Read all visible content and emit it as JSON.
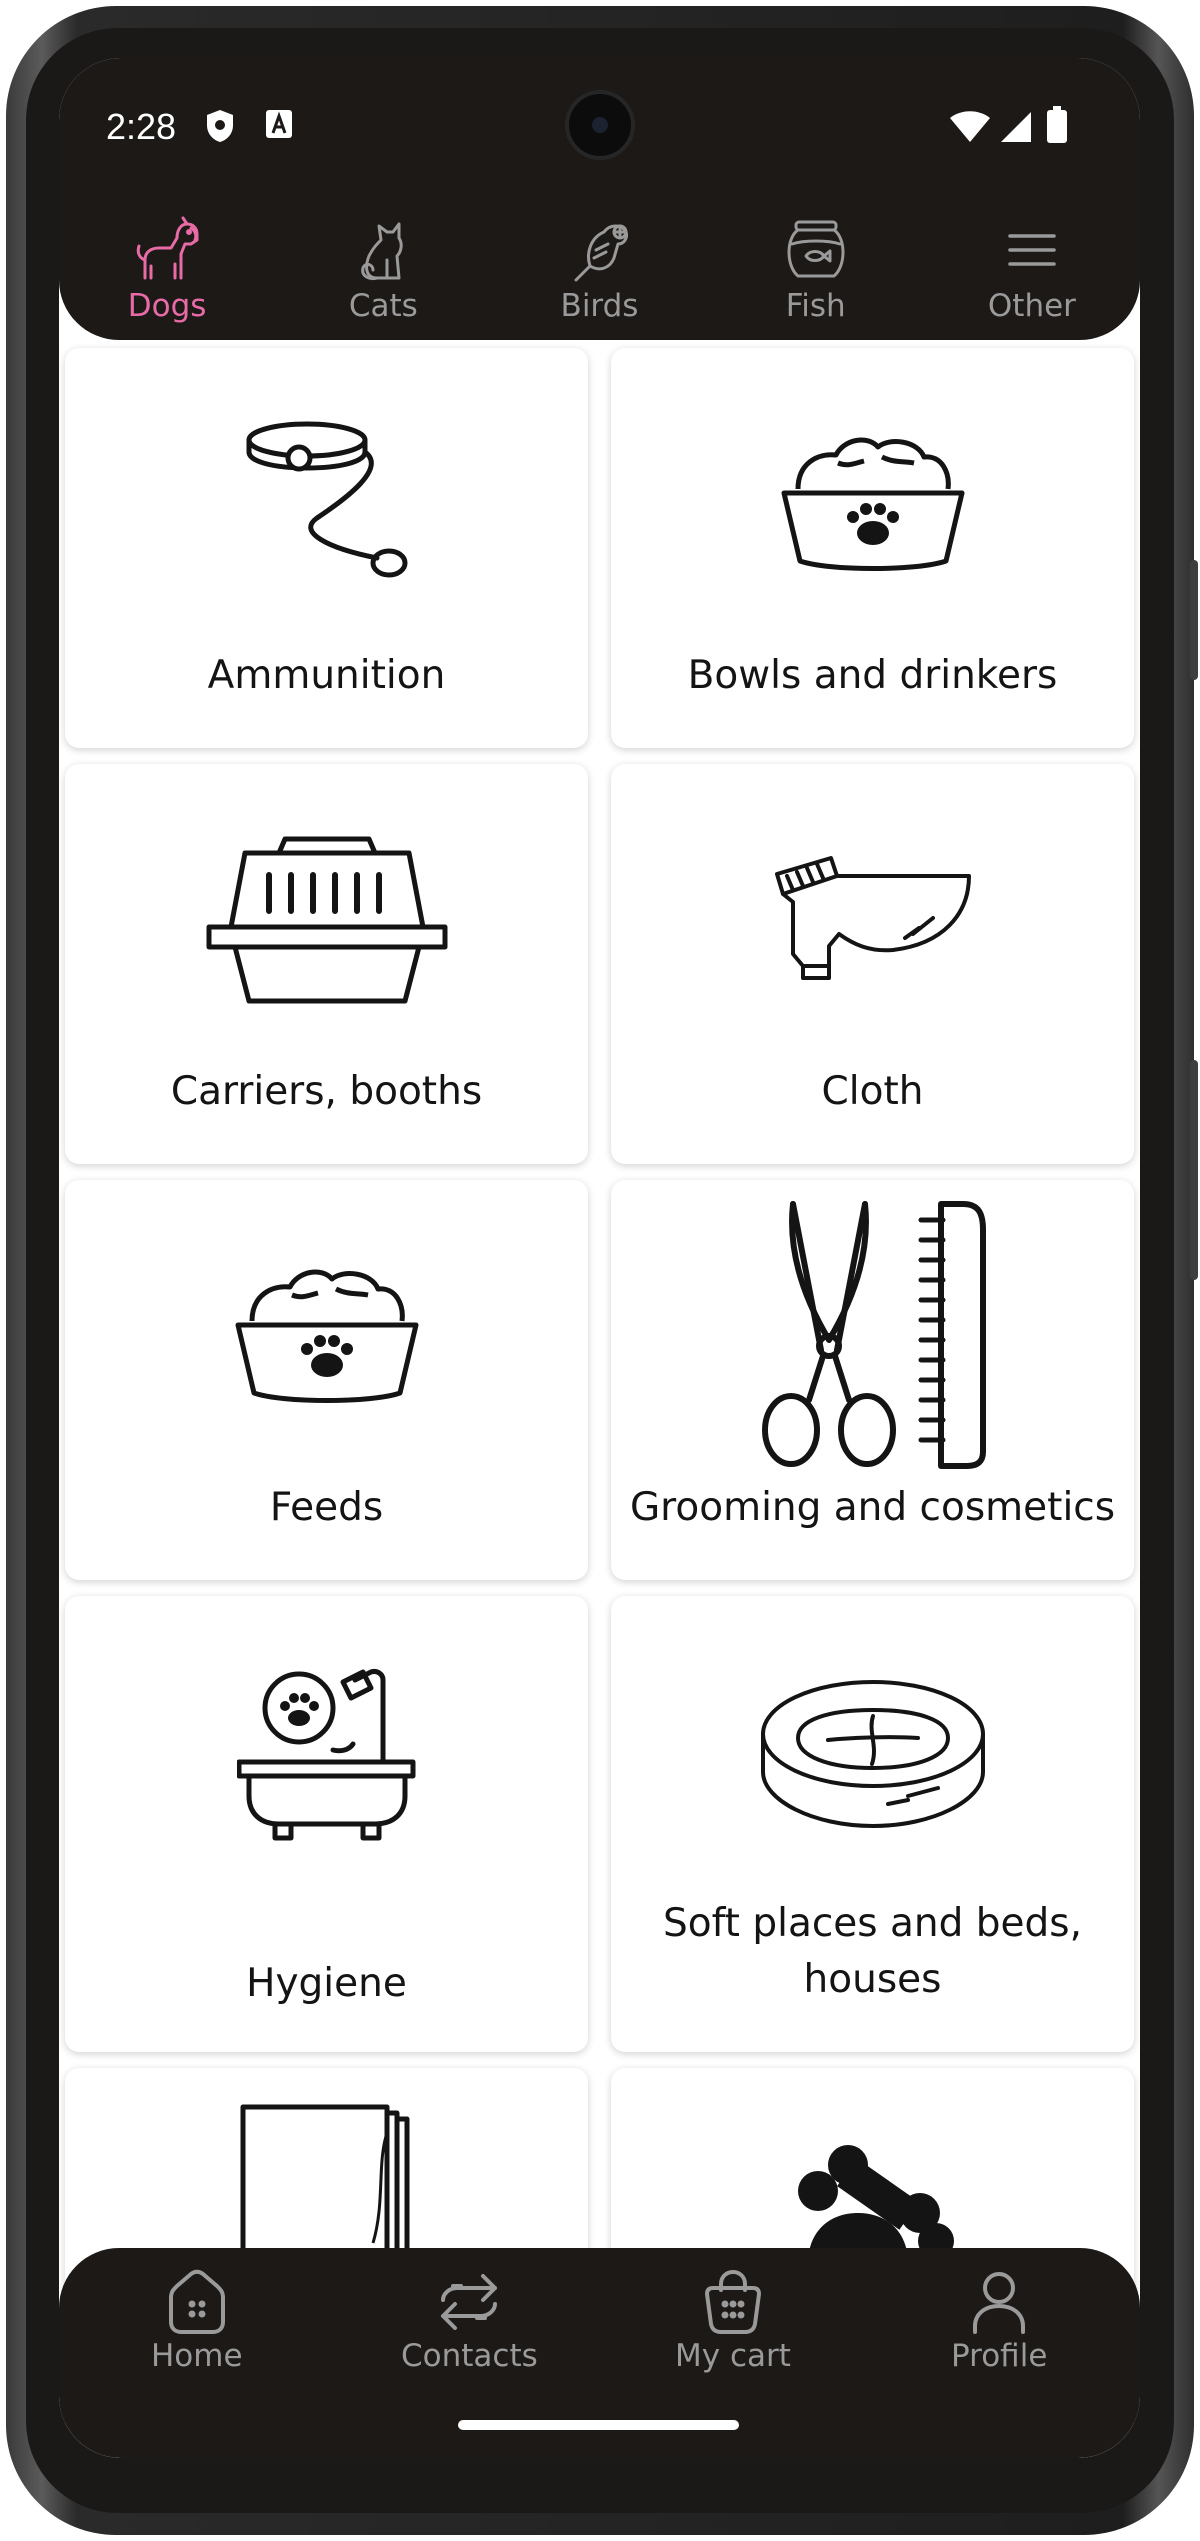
{
  "status_bar": {
    "time": "2:28",
    "icons": [
      "shield-icon",
      "a-icon",
      "wifi-icon",
      "signal-icon",
      "battery-icon"
    ]
  },
  "top_tabs": [
    {
      "label": "Dogs",
      "icon": "dog-icon",
      "active": true
    },
    {
      "label": "Cats",
      "icon": "cat-icon",
      "active": false
    },
    {
      "label": "Birds",
      "icon": "bird-icon",
      "active": false
    },
    {
      "label": "Fish",
      "icon": "fish-icon",
      "active": false
    },
    {
      "label": "Other",
      "icon": "menu-icon",
      "active": false
    }
  ],
  "categories": [
    {
      "label": "Ammunition",
      "icon": "leash-collar-icon"
    },
    {
      "label": "Bowls and drinkers",
      "icon": "food-bowl-icon"
    },
    {
      "label": "Carriers, booths",
      "icon": "pet-carrier-icon"
    },
    {
      "label": "Cloth",
      "icon": "dog-coat-icon"
    },
    {
      "label": "Feeds",
      "icon": "food-bowl-icon"
    },
    {
      "label": "Grooming and cosmetics",
      "icon": "scissors-comb-icon"
    },
    {
      "label": "Hygiene",
      "icon": "bathtub-icon"
    },
    {
      "label": "Soft places and beds, houses",
      "icon": "pet-bed-icon"
    },
    {
      "label": "",
      "icon": "book-icon"
    },
    {
      "label": "",
      "icon": "bone-toy-icon"
    }
  ],
  "bottom_nav": [
    {
      "label": "Home",
      "icon": "home-icon"
    },
    {
      "label": "Contacts",
      "icon": "contacts-arrows-icon"
    },
    {
      "label": "My cart",
      "icon": "cart-basket-icon"
    },
    {
      "label": "Profile",
      "icon": "profile-icon"
    }
  ],
  "colors": {
    "bar_background": "#1c1917",
    "active_tab": "#e86ba6",
    "inactive": "#9a9a9a",
    "card_text": "#141414"
  }
}
